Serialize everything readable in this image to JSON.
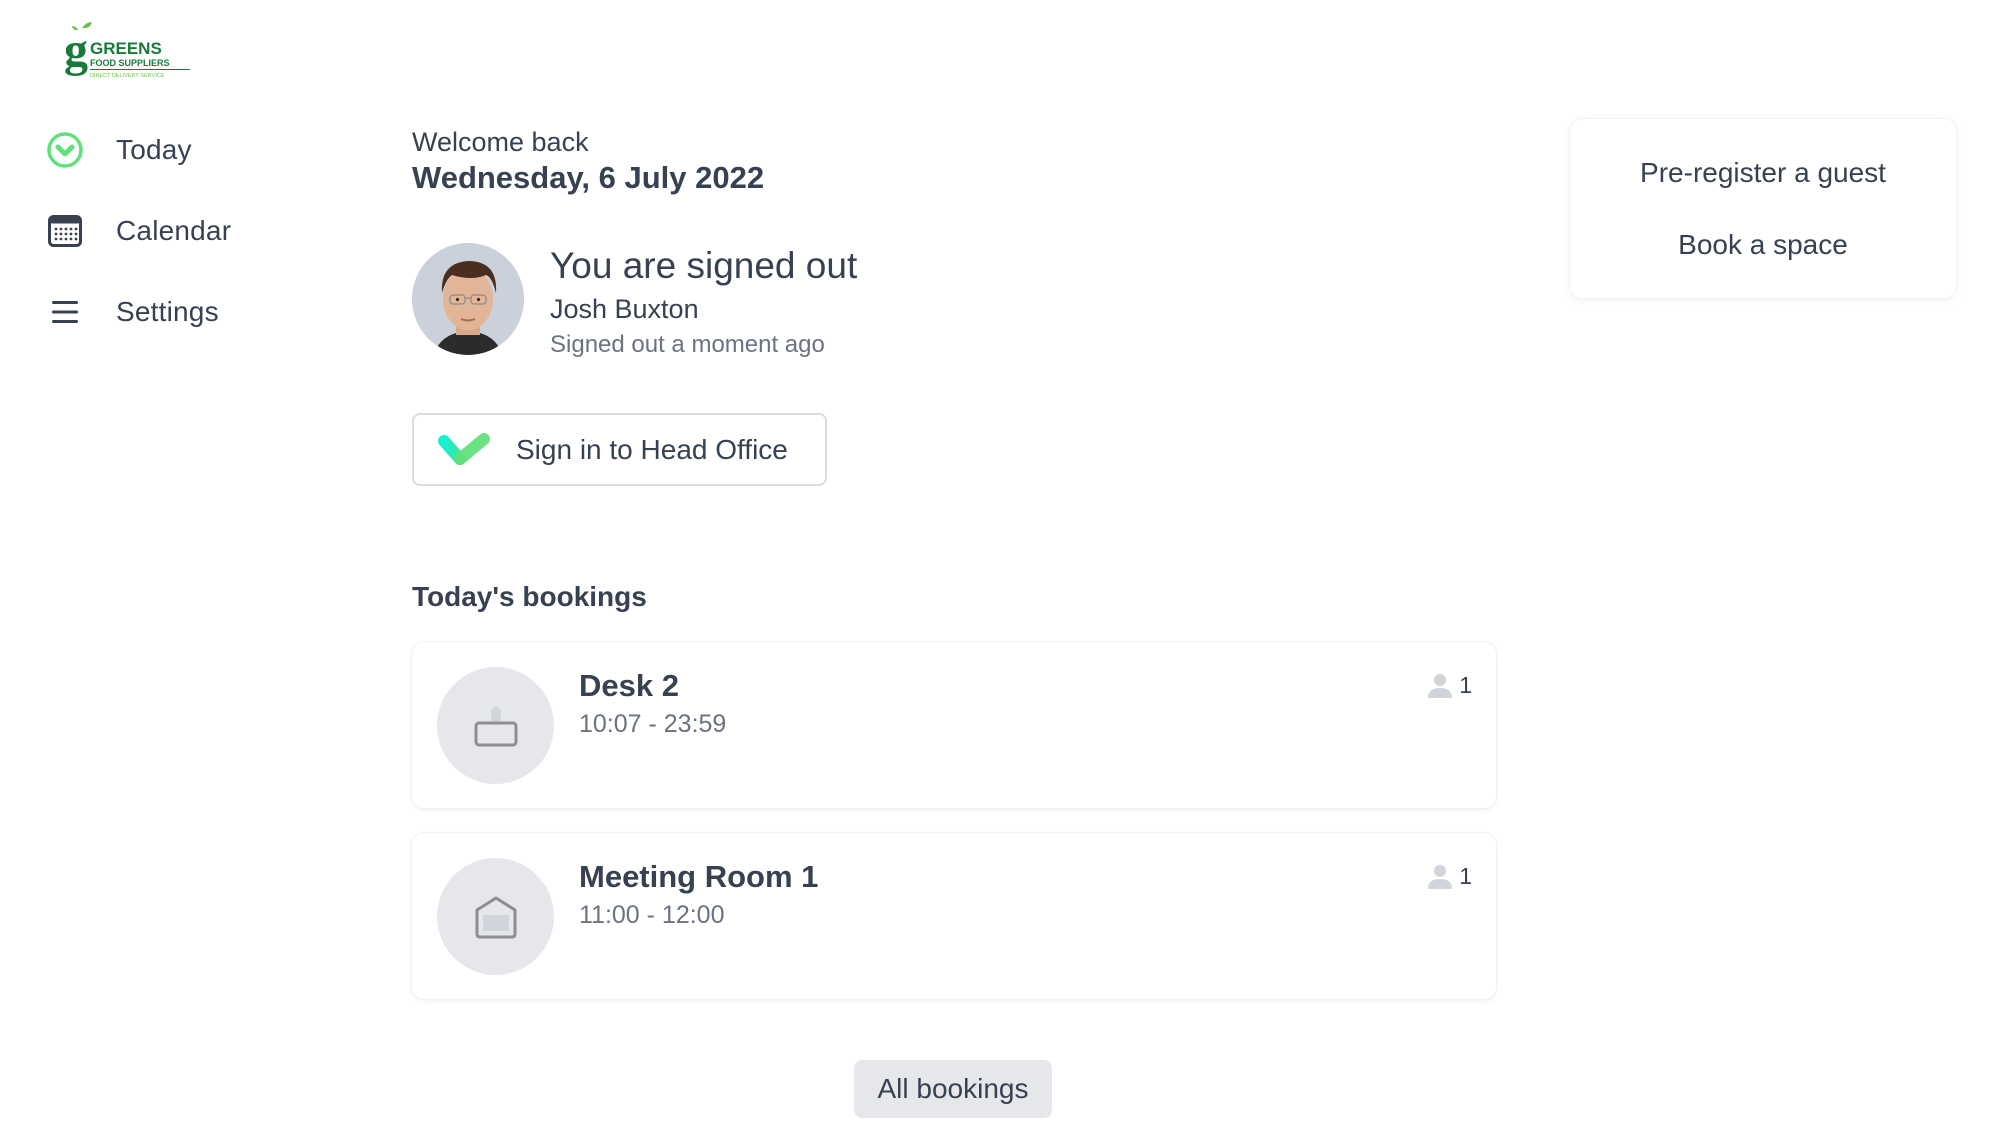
{
  "brand": {
    "name": "GREENS",
    "subtitle": "FOOD SUPPLIERS",
    "tagline": "DIRECT DELIVERY SERVICE",
    "color": "#1a7a3c"
  },
  "sidebar": {
    "items": [
      {
        "label": "Today",
        "icon": "check-circle-icon",
        "active": true
      },
      {
        "label": "Calendar",
        "icon": "calendar-icon",
        "active": false
      },
      {
        "label": "Settings",
        "icon": "menu-icon",
        "active": false
      }
    ]
  },
  "header": {
    "welcome": "Welcome back",
    "date": "Wednesday, 6 July 2022"
  },
  "status": {
    "title": "You are signed out",
    "user_name": "Josh Buxton",
    "time_text": "Signed out a moment ago"
  },
  "sign_in": {
    "label": "Sign in to Head Office",
    "icon": "check-logo-icon"
  },
  "bookings": {
    "title": "Today's bookings",
    "items": [
      {
        "name": "Desk 2",
        "time": "10:07 - 23:59",
        "attendees": "1",
        "icon": "desk-icon"
      },
      {
        "name": "Meeting Room 1",
        "time": "11:00 - 12:00",
        "attendees": "1",
        "icon": "meeting-room-icon"
      }
    ],
    "all_label": "All bookings"
  },
  "actions": {
    "items": [
      {
        "label": "Pre-register a guest"
      },
      {
        "label": "Book a space"
      }
    ]
  },
  "colors": {
    "accent_green": "#5fe07a",
    "text": "#374151",
    "muted": "#6b7280",
    "icon_bg": "#e5e7eb"
  }
}
